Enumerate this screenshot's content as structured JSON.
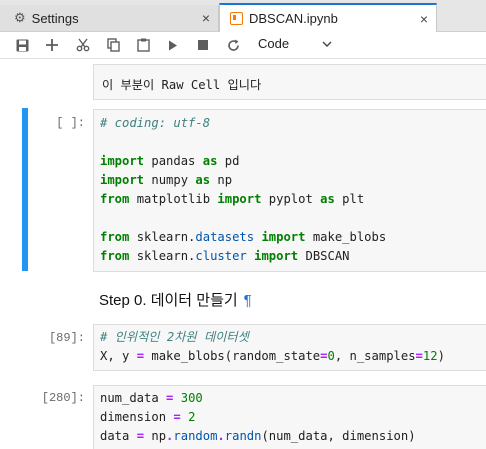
{
  "tabs": [
    {
      "label": "Settings",
      "icon": "gear-icon",
      "close": "×"
    },
    {
      "label": "DBSCAN.ipynb",
      "icon": "notebook-icon",
      "close": "×"
    }
  ],
  "toolbar": {
    "cell_type": "Code"
  },
  "cells": {
    "raw": {
      "text": "이 부분이 Raw Cell 입니다"
    },
    "c1": {
      "prompt": "[ ]:"
    },
    "md": {
      "text": "Step 0. 데이터 만들기",
      "pilcrow": "¶"
    },
    "c2": {
      "prompt": "[89]:"
    },
    "c3": {
      "prompt": "[280]:"
    }
  },
  "code": {
    "c1_l1": "# coding: utf-8",
    "import": "import",
    "from": "from",
    "as": "as",
    "pandas": " pandas ",
    "pd": " pd",
    "numpy": " numpy ",
    "np": " np",
    "matplotlib": " matplotlib ",
    "pyplot": " pyplot ",
    "plt": " plt",
    "sklearn": " sklearn.",
    "datasets": "datasets",
    "make_blobs": " make_blobs",
    "cluster": "cluster",
    "DBSCAN": " DBSCAN",
    "c2_l1": "# 인위적인 2차원 데이터셋",
    "c2_l2a": "X, y ",
    "eq": "=",
    "c2_l2b": " make_blobs(random_state",
    "zero": "0",
    "c2_l2c": ", n_samples",
    "twelve": "12",
    "rp": ")",
    "c3_l1a": "num_data ",
    "n300": "300",
    "c3_l2a": "dimension ",
    "n2": "2",
    "c3_l3a": "data ",
    "c3_l3b": " np",
    "dot": ".",
    "random": "random",
    "randn": "randn",
    "c3_l3c": "(num_data, dimension)"
  }
}
